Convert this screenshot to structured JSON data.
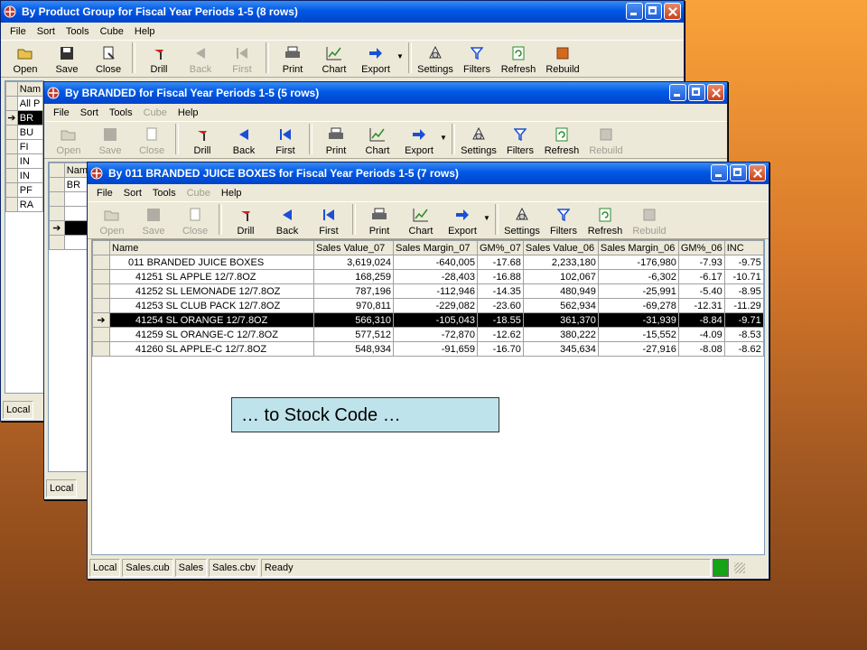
{
  "window1": {
    "title": "By Product Group for Fiscal Year Periods 1-5  (8 rows)",
    "menu": [
      "File",
      "Sort",
      "Tools",
      "Cube",
      "Help"
    ],
    "toolbar": [
      "Open",
      "Save",
      "Close",
      "Drill",
      "Back",
      "First",
      "Print",
      "Chart",
      "Export",
      "Settings",
      "Filters",
      "Refresh",
      "Rebuild"
    ],
    "grid_header": "Nam",
    "rows": [
      "All P",
      "BR",
      "BU",
      "FI",
      "IN",
      "IN",
      "PF",
      "RA"
    ],
    "status": "Local"
  },
  "window2": {
    "title": "By BRANDED for Fiscal Year Periods 1-5  (5 rows)",
    "menu": [
      "File",
      "Sort",
      "Tools",
      "Cube",
      "Help"
    ],
    "toolbar": [
      "Open",
      "Save",
      "Close",
      "Drill",
      "Back",
      "First",
      "Print",
      "Chart",
      "Export",
      "Settings",
      "Filters",
      "Refresh",
      "Rebuild"
    ],
    "grid_header": "Nam",
    "rows": [
      "BR"
    ],
    "status": "Local"
  },
  "window3": {
    "title": "By 011 BRANDED JUICE BOXES for Fiscal Year Periods 1-5  (7 rows)",
    "menu": [
      "File",
      "Sort",
      "Tools",
      "Cube",
      "Help"
    ],
    "toolbar": [
      "Open",
      "Save",
      "Close",
      "Drill",
      "Back",
      "First",
      "Print",
      "Chart",
      "Export",
      "Settings",
      "Filters",
      "Refresh",
      "Rebuild"
    ],
    "columns": [
      "Name",
      "Sales Value_07",
      "Sales Margin_07",
      "GM%_07",
      "Sales Value_06",
      "Sales Margin_06",
      "GM%_06",
      "INC"
    ],
    "rows": [
      [
        "011 BRANDED JUICE BOXES",
        "3,619,024",
        "-640,005",
        "-17.68",
        "2,233,180",
        "-176,980",
        "-7.93",
        "-9.75"
      ],
      [
        "41251 SL APPLE 12/7.8OZ",
        "168,259",
        "-28,403",
        "-16.88",
        "102,067",
        "-6,302",
        "-6.17",
        "-10.71"
      ],
      [
        "41252 SL LEMONADE 12/7.8OZ",
        "787,196",
        "-112,946",
        "-14.35",
        "480,949",
        "-25,991",
        "-5.40",
        "-8.95"
      ],
      [
        "41253 SL CLUB PACK 12/7.8OZ",
        "970,811",
        "-229,082",
        "-23.60",
        "562,934",
        "-69,278",
        "-12.31",
        "-11.29"
      ],
      [
        "41254 SL ORANGE 12/7.8OZ",
        "566,310",
        "-105,043",
        "-18.55",
        "361,370",
        "-31,939",
        "-8.84",
        "-9.71"
      ],
      [
        "41259 SL ORANGE-C 12/7.8OZ",
        "577,512",
        "-72,870",
        "-12.62",
        "380,222",
        "-15,552",
        "-4.09",
        "-8.53"
      ],
      [
        "41260 SL APPLE-C 12/7.8OZ",
        "548,934",
        "-91,659",
        "-16.70",
        "345,634",
        "-27,916",
        "-8.08",
        "-8.62"
      ]
    ],
    "status": [
      "Local",
      "Sales.cub",
      "Sales",
      "Sales.cbv",
      "Ready"
    ]
  },
  "callout": "… to Stock Code …",
  "colors": {
    "title_bar": "#0058e6",
    "window_face": "#ece9d8",
    "callout_bg": "#bfe3ea",
    "ready_indicator": "#17a317"
  }
}
